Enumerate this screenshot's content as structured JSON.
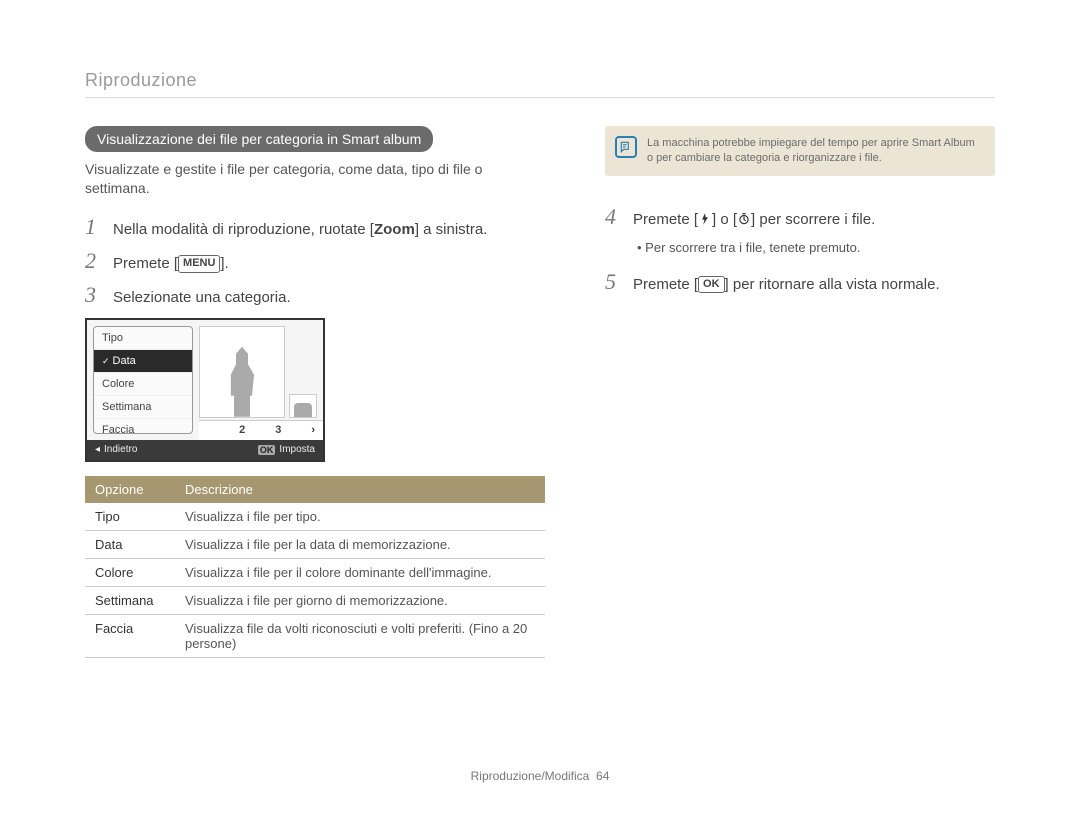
{
  "breadcrumb": "Riproduzione",
  "left": {
    "section_heading": "Visualizzazione dei file per categoria in Smart album",
    "intro": "Visualizzate e gestite i file per categoria, come data, tipo di file o settimana.",
    "step1_pre": "Nella modalità di riproduzione, ruotate [",
    "step1_bold": "Zoom",
    "step1_post": "] a sinistra.",
    "step2_pre": "Premete [",
    "step2_btn": "MENU",
    "step2_post": "].",
    "step3": "Selezionate una categoria.",
    "screen": {
      "menu": [
        "Tipo",
        "Data",
        "Colore",
        "Settimana",
        "Faccia"
      ],
      "selected_index": 1,
      "pager": {
        "two": "2",
        "three": "3",
        "arrow": "›"
      },
      "footer_back_arrow": "◂",
      "footer_back": "Indietro",
      "footer_ok": "OK",
      "footer_set": "Imposta"
    },
    "table": {
      "h1": "Opzione",
      "h2": "Descrizione",
      "rows": [
        {
          "opt": "Tipo",
          "desc": "Visualizza i file per tipo."
        },
        {
          "opt": "Data",
          "desc": "Visualizza i file per la data di memorizzazione."
        },
        {
          "opt": "Colore",
          "desc": "Visualizza i file per il colore dominante dell'immagine."
        },
        {
          "opt": "Settimana",
          "desc": "Visualizza i file per giorno di memorizzazione."
        },
        {
          "opt": "Faccia",
          "desc": "Visualizza file da volti riconosciuti e volti preferiti. (Fino a 20 persone)"
        }
      ]
    }
  },
  "right": {
    "note": "La macchina potrebbe impiegare del tempo per aprire Smart Album o per cambiare la categoria e riorganizzare i file.",
    "step4_pre": "Premete [",
    "step4_mid": "] o [",
    "step4_post": "] per scorrere i file.",
    "step4_sub": "Per scorrere tra i file, tenete premuto.",
    "step5_pre": "Premete [",
    "step5_btn": "OK",
    "step5_post": "] per ritornare alla vista normale."
  },
  "step_numbers": {
    "s1": "1",
    "s2": "2",
    "s3": "3",
    "s4": "4",
    "s5": "5"
  },
  "footer": {
    "section": "Riproduzione/Modifica",
    "page": "64"
  }
}
